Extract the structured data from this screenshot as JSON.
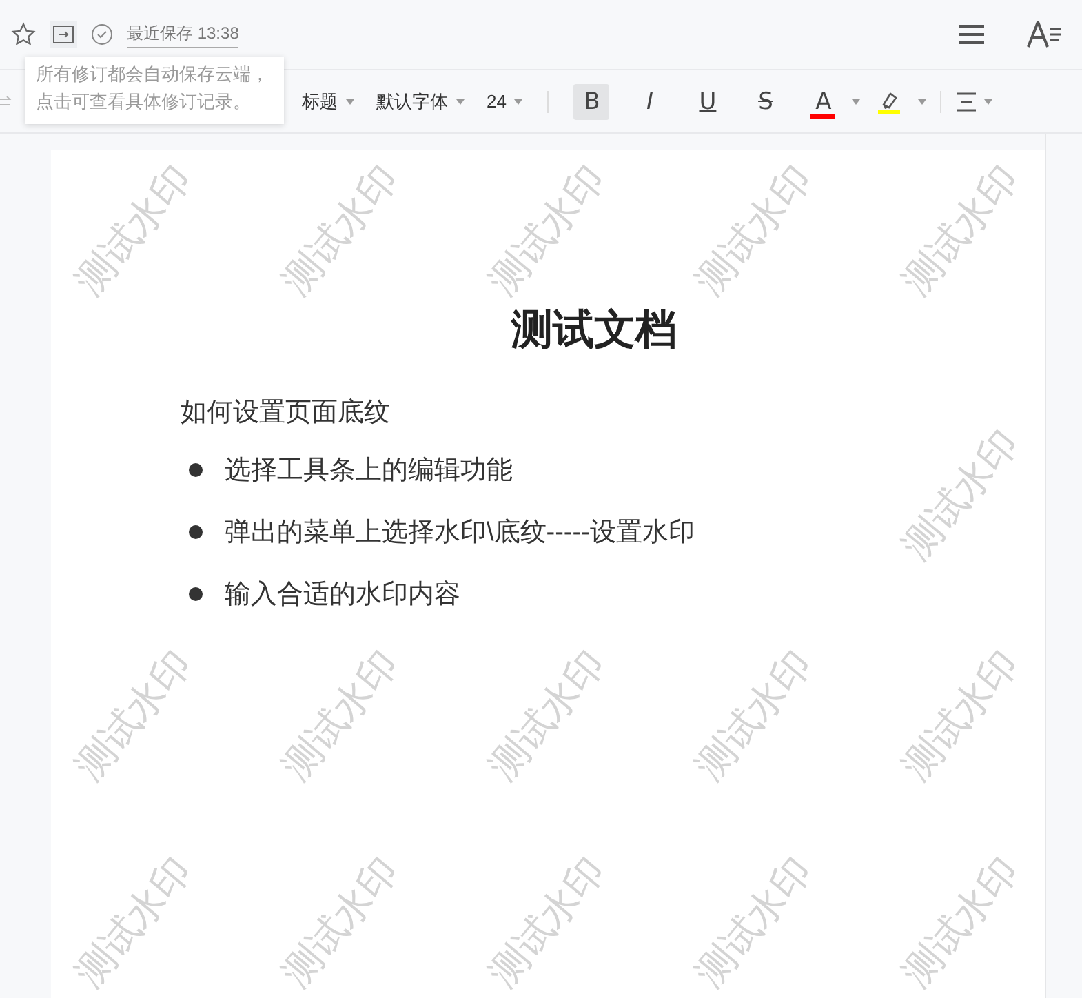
{
  "header": {
    "save_status": "最近保存 13:38"
  },
  "tooltip": {
    "text": "所有修订都会自动保存云端，点击可查看具体修订记录。"
  },
  "toolbar": {
    "dropdowns": [
      {
        "label": "标题"
      },
      {
        "label": "默认字体"
      },
      {
        "label": "24"
      }
    ],
    "formats": [
      {
        "kind": "bold",
        "label": "B",
        "selected": true
      },
      {
        "kind": "italic",
        "label": "I",
        "selected": false
      },
      {
        "kind": "underline",
        "label": "U",
        "selected": false
      },
      {
        "kind": "strike",
        "label": "S",
        "selected": false
      },
      {
        "kind": "fontcolor",
        "label": "A",
        "selected": false,
        "color": "#ff0000"
      },
      {
        "kind": "highlight",
        "selected": false,
        "color": "#ffff00"
      }
    ]
  },
  "document": {
    "title": "测试文档",
    "paragraph": "如何设置页面底纹",
    "bullets": [
      "选择工具条上的编辑功能",
      "弹出的菜单上选择水印\\底纹-----设置水印",
      "输入合适的水印内容"
    ],
    "watermarks": [
      "测试水印",
      "测试水印",
      "测试水印",
      "测试水印",
      "测试水印",
      "测试水印",
      "测试水印",
      "测试水印",
      "测试水印",
      "测试水印",
      "测试水印",
      "测试水印",
      "测试水印",
      "测试水印",
      "测试水印",
      "测试水印"
    ]
  }
}
